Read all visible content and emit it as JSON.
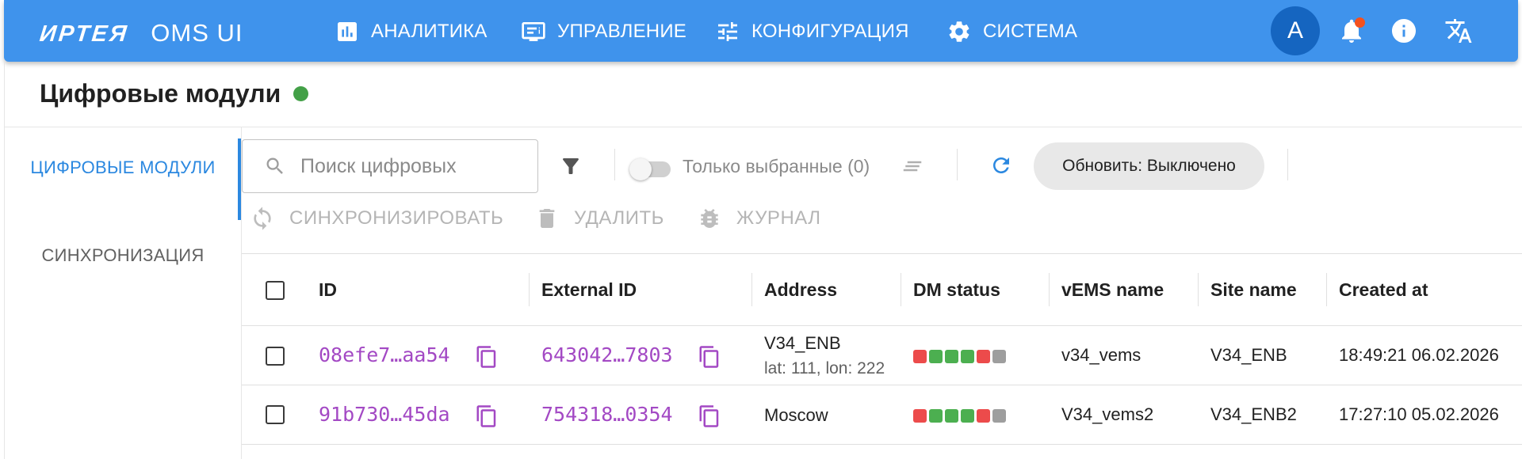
{
  "appbar": {
    "brand": "ИРТЕЯ",
    "product": "OMS UI",
    "nav": [
      {
        "label": "АНАЛИТИКА",
        "icon": "analytics-icon"
      },
      {
        "label": "УПРАВЛЕНИЕ",
        "icon": "management-icon"
      },
      {
        "label": "КОНФИГУРАЦИЯ",
        "icon": "tune-icon"
      },
      {
        "label": "СИСТЕМА",
        "icon": "gear-icon"
      }
    ],
    "avatar_letter": "A",
    "icons": [
      "bell-icon",
      "info-icon",
      "translate-icon"
    ]
  },
  "page": {
    "title": "Цифровые модули",
    "status_color": "#43a047"
  },
  "sidenav": {
    "items": [
      {
        "label": "ЦИФРОВЫЕ МОДУЛИ",
        "active": true
      },
      {
        "label": "СИНХРОНИЗАЦИЯ",
        "active": false
      }
    ]
  },
  "toolbar": {
    "search_placeholder": "Поиск цифровых",
    "only_selected_label": "Только выбранные (0)",
    "refresh_label": "Обновить: Выключено",
    "actions": {
      "sync": "СИНХРОНИЗИРОВАТЬ",
      "delete": "УДАЛИТЬ",
      "journal": "ЖУРНАЛ"
    }
  },
  "table": {
    "columns": [
      "ID",
      "External ID",
      "Address",
      "DM status",
      "vEMS name",
      "Site name",
      "Created at"
    ],
    "rows": [
      {
        "id": "08efe7…aa54",
        "external_id": "643042…7803",
        "address": "V34_ENB",
        "address_sub": "lat: 111, lon: 222",
        "dm_status": [
          "red",
          "green",
          "green",
          "green",
          "red",
          "gray"
        ],
        "vems_name": "v34_vems",
        "site_name": "V34_ENB",
        "created_at": "18:49:21 06.02.2026"
      },
      {
        "id": "91b730…45da",
        "external_id": "754318…0354",
        "address": "Moscow",
        "address_sub": "",
        "dm_status": [
          "red",
          "green",
          "green",
          "green",
          "red",
          "gray"
        ],
        "vems_name": "V34_vems2",
        "site_name": "V34_ENB2",
        "created_at": "17:27:10 05.02.2026"
      }
    ]
  },
  "colors": {
    "appbar": "#3f93ec",
    "accent": "#2b88e0",
    "id_link": "#a349c4",
    "status_red": "#ec4b4b",
    "status_green": "#4caf50",
    "status_gray": "#9e9e9e"
  }
}
